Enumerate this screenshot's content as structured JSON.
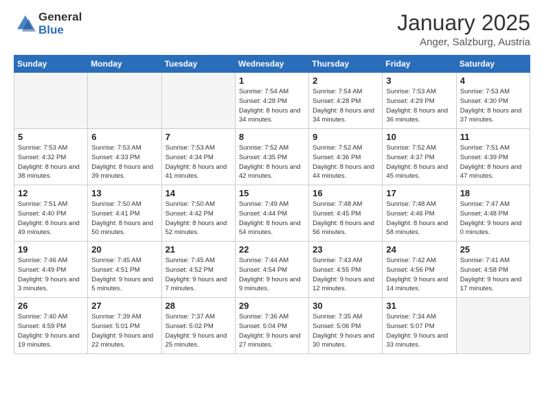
{
  "header": {
    "logo_general": "General",
    "logo_blue": "Blue",
    "month": "January 2025",
    "location": "Anger, Salzburg, Austria"
  },
  "weekdays": [
    "Sunday",
    "Monday",
    "Tuesday",
    "Wednesday",
    "Thursday",
    "Friday",
    "Saturday"
  ],
  "weeks": [
    [
      {
        "day": "",
        "info": ""
      },
      {
        "day": "",
        "info": ""
      },
      {
        "day": "",
        "info": ""
      },
      {
        "day": "1",
        "info": "Sunrise: 7:54 AM\nSunset: 4:28 PM\nDaylight: 8 hours\nand 34 minutes."
      },
      {
        "day": "2",
        "info": "Sunrise: 7:54 AM\nSunset: 4:28 PM\nDaylight: 8 hours\nand 34 minutes."
      },
      {
        "day": "3",
        "info": "Sunrise: 7:53 AM\nSunset: 4:29 PM\nDaylight: 8 hours\nand 36 minutes."
      },
      {
        "day": "4",
        "info": "Sunrise: 7:53 AM\nSunset: 4:30 PM\nDaylight: 8 hours\nand 37 minutes."
      }
    ],
    [
      {
        "day": "5",
        "info": "Sunrise: 7:53 AM\nSunset: 4:32 PM\nDaylight: 8 hours\nand 38 minutes."
      },
      {
        "day": "6",
        "info": "Sunrise: 7:53 AM\nSunset: 4:33 PM\nDaylight: 8 hours\nand 39 minutes."
      },
      {
        "day": "7",
        "info": "Sunrise: 7:53 AM\nSunset: 4:34 PM\nDaylight: 8 hours\nand 41 minutes."
      },
      {
        "day": "8",
        "info": "Sunrise: 7:52 AM\nSunset: 4:35 PM\nDaylight: 8 hours\nand 42 minutes."
      },
      {
        "day": "9",
        "info": "Sunrise: 7:52 AM\nSunset: 4:36 PM\nDaylight: 8 hours\nand 44 minutes."
      },
      {
        "day": "10",
        "info": "Sunrise: 7:52 AM\nSunset: 4:37 PM\nDaylight: 8 hours\nand 45 minutes."
      },
      {
        "day": "11",
        "info": "Sunrise: 7:51 AM\nSunset: 4:39 PM\nDaylight: 8 hours\nand 47 minutes."
      }
    ],
    [
      {
        "day": "12",
        "info": "Sunrise: 7:51 AM\nSunset: 4:40 PM\nDaylight: 8 hours\nand 49 minutes."
      },
      {
        "day": "13",
        "info": "Sunrise: 7:50 AM\nSunset: 4:41 PM\nDaylight: 8 hours\nand 50 minutes."
      },
      {
        "day": "14",
        "info": "Sunrise: 7:50 AM\nSunset: 4:42 PM\nDaylight: 8 hours\nand 52 minutes."
      },
      {
        "day": "15",
        "info": "Sunrise: 7:49 AM\nSunset: 4:44 PM\nDaylight: 8 hours\nand 54 minutes."
      },
      {
        "day": "16",
        "info": "Sunrise: 7:48 AM\nSunset: 4:45 PM\nDaylight: 8 hours\nand 56 minutes."
      },
      {
        "day": "17",
        "info": "Sunrise: 7:48 AM\nSunset: 4:46 PM\nDaylight: 8 hours\nand 58 minutes."
      },
      {
        "day": "18",
        "info": "Sunrise: 7:47 AM\nSunset: 4:48 PM\nDaylight: 9 hours\nand 0 minutes."
      }
    ],
    [
      {
        "day": "19",
        "info": "Sunrise: 7:46 AM\nSunset: 4:49 PM\nDaylight: 9 hours\nand 3 minutes."
      },
      {
        "day": "20",
        "info": "Sunrise: 7:45 AM\nSunset: 4:51 PM\nDaylight: 9 hours\nand 5 minutes."
      },
      {
        "day": "21",
        "info": "Sunrise: 7:45 AM\nSunset: 4:52 PM\nDaylight: 9 hours\nand 7 minutes."
      },
      {
        "day": "22",
        "info": "Sunrise: 7:44 AM\nSunset: 4:54 PM\nDaylight: 9 hours\nand 9 minutes."
      },
      {
        "day": "23",
        "info": "Sunrise: 7:43 AM\nSunset: 4:55 PM\nDaylight: 9 hours\nand 12 minutes."
      },
      {
        "day": "24",
        "info": "Sunrise: 7:42 AM\nSunset: 4:56 PM\nDaylight: 9 hours\nand 14 minutes."
      },
      {
        "day": "25",
        "info": "Sunrise: 7:41 AM\nSunset: 4:58 PM\nDaylight: 9 hours\nand 17 minutes."
      }
    ],
    [
      {
        "day": "26",
        "info": "Sunrise: 7:40 AM\nSunset: 4:59 PM\nDaylight: 9 hours\nand 19 minutes."
      },
      {
        "day": "27",
        "info": "Sunrise: 7:39 AM\nSunset: 5:01 PM\nDaylight: 9 hours\nand 22 minutes."
      },
      {
        "day": "28",
        "info": "Sunrise: 7:37 AM\nSunset: 5:02 PM\nDaylight: 9 hours\nand 25 minutes."
      },
      {
        "day": "29",
        "info": "Sunrise: 7:36 AM\nSunset: 5:04 PM\nDaylight: 9 hours\nand 27 minutes."
      },
      {
        "day": "30",
        "info": "Sunrise: 7:35 AM\nSunset: 5:06 PM\nDaylight: 9 hours\nand 30 minutes."
      },
      {
        "day": "31",
        "info": "Sunrise: 7:34 AM\nSunset: 5:07 PM\nDaylight: 9 hours\nand 33 minutes."
      },
      {
        "day": "",
        "info": ""
      }
    ]
  ]
}
